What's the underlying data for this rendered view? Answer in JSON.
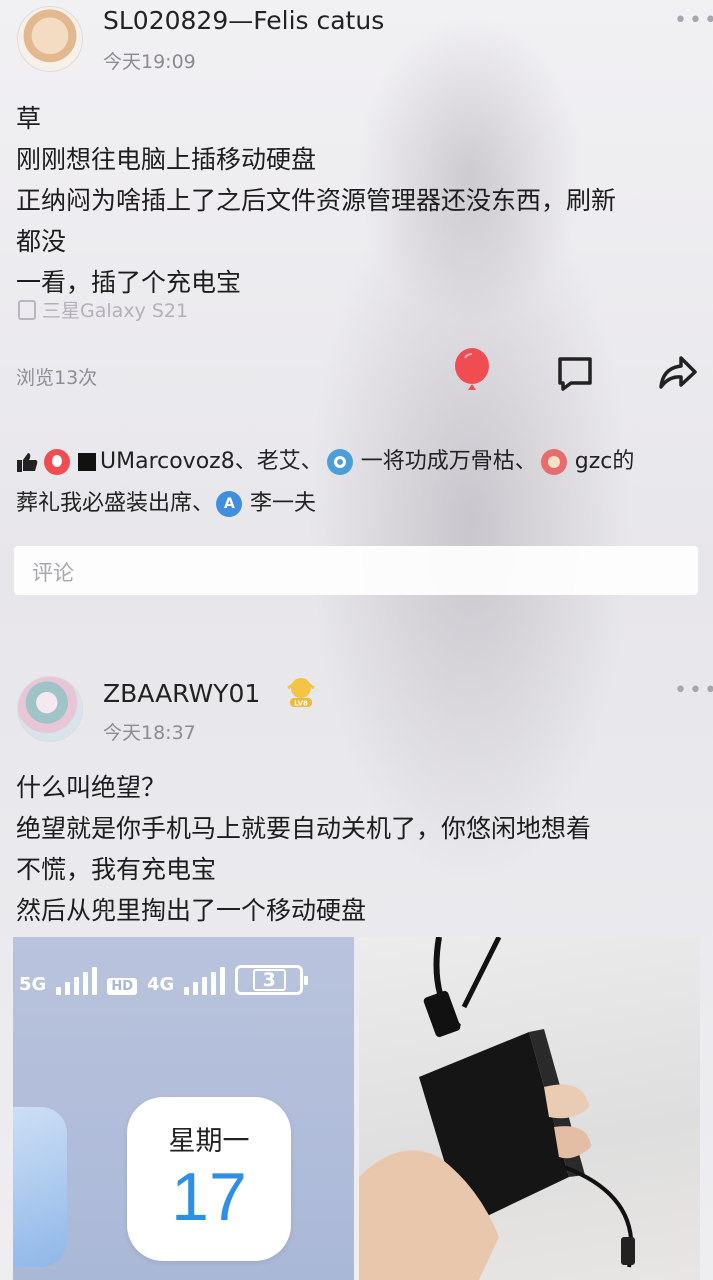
{
  "posts": [
    {
      "username": "SL020829—Felis catus",
      "time": "今天19:09",
      "lines": [
        "草",
        "刚刚想往电脑上插移动硬盘",
        "正纳闷为啥插上了之后文件资源管理器还没东西，刷新",
        "都没",
        "一看，插了个充电宝"
      ],
      "device": "三星Galaxy S21",
      "views": "浏览13次",
      "likes_line1": [
        "UMarcovoz8、老艾、",
        "一将功成万骨枯、",
        "gzc的"
      ],
      "likes_line2": [
        "葬礼我必盛装出席、",
        "李一夫"
      ],
      "comment_placeholder": "评论"
    },
    {
      "username": "ZBAARWY01",
      "badge_text": "LV8",
      "time": "今天18:37",
      "lines": [
        "什么叫绝望？",
        "绝望就是你手机马上就要自动关机了，你悠闲地想着",
        "不慌，我有充电宝",
        "然后从兜里掏出了一个移动硬盘"
      ],
      "screenshot": {
        "signal1": "5G",
        "hd": "HD",
        "signal2": "4G",
        "battery": "3",
        "weekday": "星期一",
        "day": "17"
      }
    }
  ],
  "colors": {
    "like_red": "#ef4d52",
    "accent_blue": "#2d8fe6"
  },
  "icons": [
    "thumbs-up-icon",
    "balloon-icon",
    "comment-icon",
    "share-icon",
    "more-icon",
    "phone-icon"
  ]
}
